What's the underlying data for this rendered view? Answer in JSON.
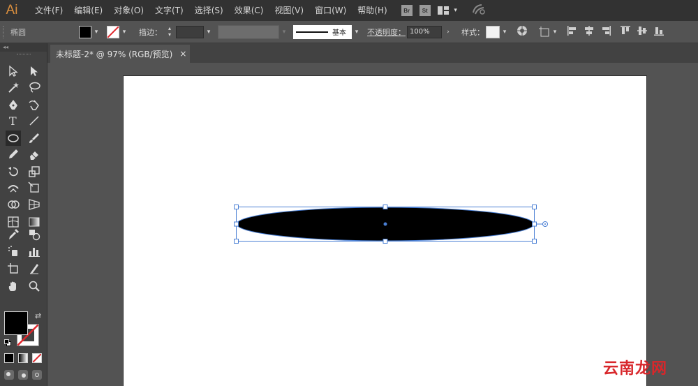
{
  "app": {
    "logo": "Ai"
  },
  "menu": [
    "文件(F)",
    "编辑(E)",
    "对象(O)",
    "文字(T)",
    "选择(S)",
    "效果(C)",
    "视图(V)",
    "窗口(W)",
    "帮助(H)"
  ],
  "topbar_icons": {
    "bridge": "Br",
    "stock": "St",
    "workspace": "workspace-switcher-icon",
    "sync": "sync-icon"
  },
  "control": {
    "object_type": "椭圆",
    "fill_color": "#000000",
    "stroke_color": "none",
    "stroke_label": "描边：",
    "stroke_style": "基本",
    "opacity_label": "不透明度：",
    "opacity_value": "100%",
    "style_label": "样式："
  },
  "document": {
    "tab_title": "未标题-2* @ 97% (RGB/预览)",
    "close": "×"
  },
  "tools": [
    "selection-tool",
    "direct-selection-tool",
    "magic-wand-tool",
    "lasso-tool",
    "pen-tool",
    "curvature-tool",
    "type-tool",
    "line-segment-tool",
    "ellipse-tool",
    "paintbrush-tool",
    "pencil-tool",
    "eraser-tool",
    "rotate-tool",
    "scale-tool",
    "width-tool",
    "free-transform-tool",
    "shape-builder-tool",
    "perspective-grid-tool",
    "mesh-tool",
    "gradient-tool",
    "eyedropper-tool",
    "blend-tool",
    "symbol-sprayer-tool",
    "column-graph-tool",
    "artboard-tool",
    "slice-tool",
    "hand-tool",
    "zoom-tool"
  ],
  "fill_stroke": {
    "fill": "#000000",
    "stroke": "none"
  },
  "shape": {
    "type": "ellipse",
    "fill": "#000000",
    "selection_color": "#4a7fd4"
  },
  "watermark": "云南龙网"
}
